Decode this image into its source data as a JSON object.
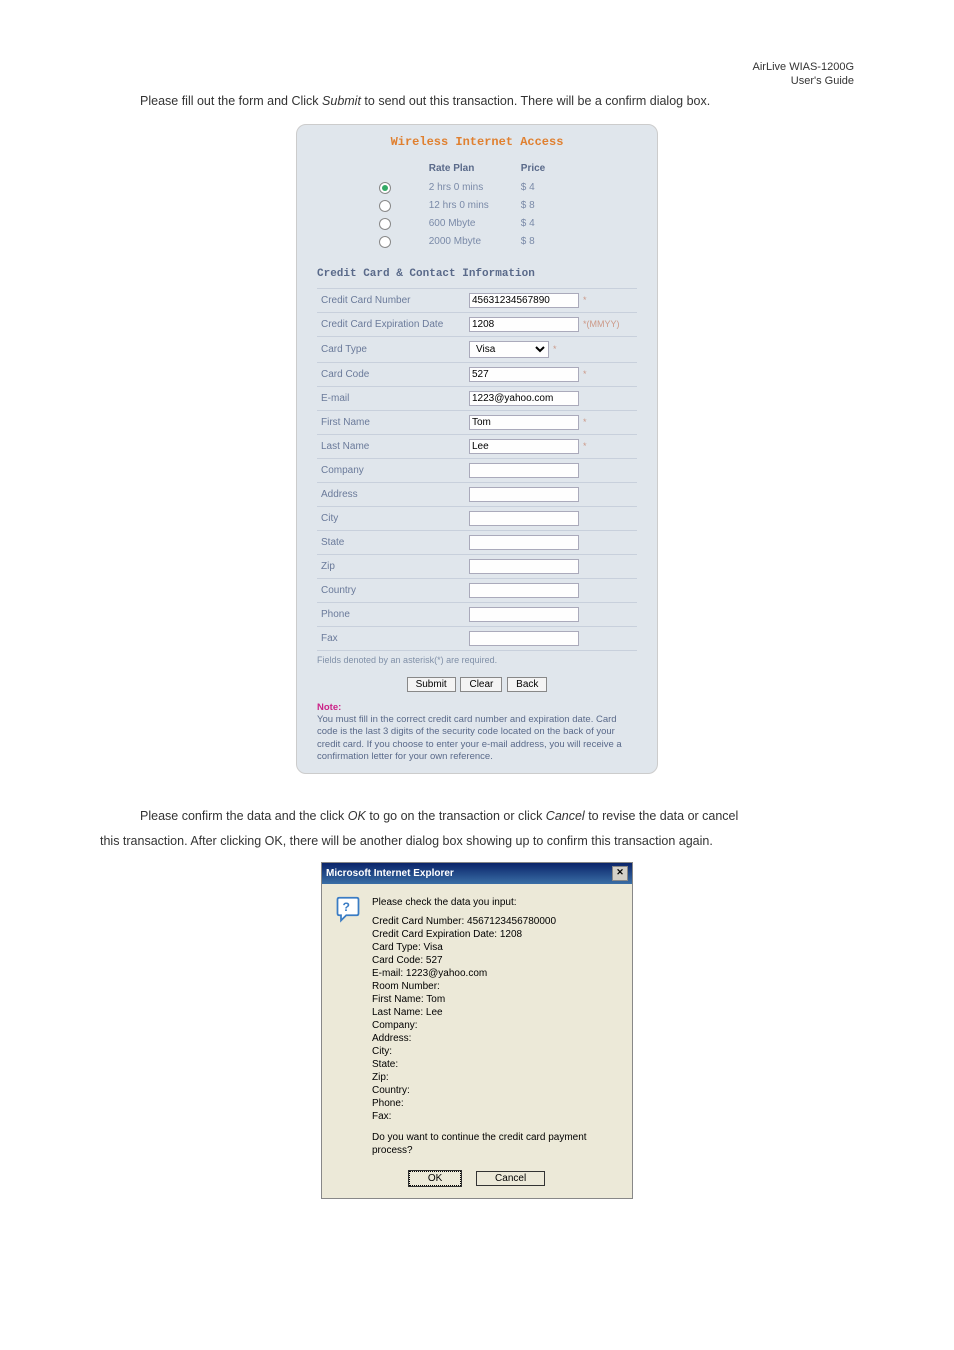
{
  "header": {
    "product": "AirLive  WIAS-1200G",
    "subtitle": "User's  Guide"
  },
  "para1_a": "Please fill out the form and Click ",
  "para1_btn": "Submit",
  "para1_b": " to send out this transaction. There will be a confirm dialog box.",
  "form": {
    "title": "Wireless Internet Access",
    "rate_header": "Rate Plan",
    "price_header": "Price",
    "plans": [
      {
        "label": "2 hrs 0 mins",
        "price": "$ 4",
        "selected": true
      },
      {
        "label": "12 hrs 0 mins",
        "price": "$ 8",
        "selected": false
      },
      {
        "label": "600 Mbyte",
        "price": "$ 4",
        "selected": false
      },
      {
        "label": "2000 Mbyte",
        "price": "$ 8",
        "selected": false
      }
    ],
    "cc_section": "Credit Card & Contact Information",
    "fields": {
      "cc_number": {
        "label": "Credit Card Number",
        "value": "45631234567890",
        "hint": "*"
      },
      "cc_exp": {
        "label": "Credit Card Expiration Date",
        "value": "1208",
        "hint": "*(MMYY)"
      },
      "card_type": {
        "label": "Card Type",
        "value": "Visa",
        "hint": "*"
      },
      "card_code": {
        "label": "Card Code",
        "value": "527",
        "hint": "*"
      },
      "email": {
        "label": "E-mail",
        "value": "1223@yahoo.com",
        "hint": ""
      },
      "first_name": {
        "label": "First Name",
        "value": "Tom",
        "hint": "*"
      },
      "last_name": {
        "label": "Last Name",
        "value": "Lee",
        "hint": "*"
      },
      "company": {
        "label": "Company",
        "value": "",
        "hint": ""
      },
      "address": {
        "label": "Address",
        "value": "",
        "hint": ""
      },
      "city": {
        "label": "City",
        "value": "",
        "hint": ""
      },
      "state": {
        "label": "State",
        "value": "",
        "hint": ""
      },
      "zip": {
        "label": "Zip",
        "value": "",
        "hint": ""
      },
      "country": {
        "label": "Country",
        "value": "",
        "hint": ""
      },
      "phone": {
        "label": "Phone",
        "value": "",
        "hint": ""
      },
      "fax": {
        "label": "Fax",
        "value": "",
        "hint": ""
      }
    },
    "required_note": "Fields denoted by an asterisk(*) are required.",
    "buttons": {
      "submit": "Submit",
      "clear": "Clear",
      "back": "Back"
    },
    "note_label": "Note:",
    "note_text": "You must fill in the correct credit card number and expiration date. Card code is the last 3 digits of the security code located on the back of your credit card. If you choose to enter your e-mail address, you will receive a confirmation letter for your own reference."
  },
  "para2_a": "Please confirm the data and the click ",
  "para2_ok": "OK",
  "para2_b": " to go on the transaction or click ",
  "para2_cancel": "Cancel",
  "para2_c": " to revise the data or cancel",
  "para3": "this transaction. After clicking OK, there will be another dialog box showing up to confirm this transaction again.",
  "dialog": {
    "title": "Microsoft Internet Explorer",
    "intro": "Please check the data you input:",
    "lines": [
      "Credit Card Number: 4567123456780000",
      "Credit Card Expiration Date: 1208",
      "Card Type: Visa",
      "Card Code: 527",
      "E-mail: 1223@yahoo.com",
      "Room Number:",
      "First Name: Tom",
      "Last Name: Lee",
      "Company:",
      "Address:",
      "City:",
      "State:",
      "Zip:",
      "Country:",
      "Phone:",
      "Fax:"
    ],
    "prompt": "Do you want to continue the credit card payment process?",
    "ok": "OK",
    "cancel": "Cancel"
  }
}
